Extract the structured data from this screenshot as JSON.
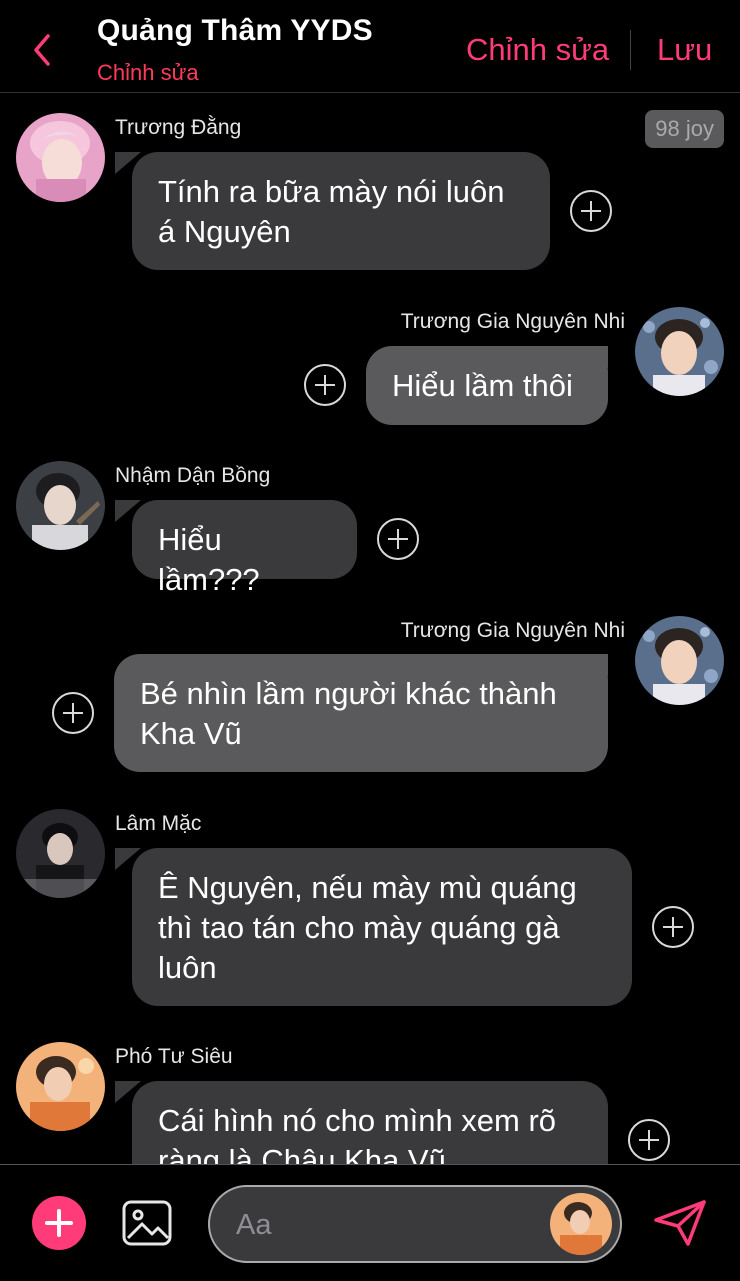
{
  "header": {
    "title": "Quảng Thâm YYDS",
    "subtitle": "Chỉnh sửa",
    "edit_label": "Chỉnh sửa",
    "save_label": "Lưu",
    "accent": "#ff3b7a"
  },
  "badge": {
    "label": "98 joy"
  },
  "messages": [
    {
      "side": "left",
      "sender": "Trương Đằng",
      "text": "Tính ra bữa mày nói luôn á Nguyên"
    },
    {
      "side": "right",
      "sender": "Trương Gia Nguyên Nhi",
      "text": "Hiểu lầm thôi"
    },
    {
      "side": "left",
      "sender": "Nhậm Dận Bồng",
      "text": "Hiểu lầm???"
    },
    {
      "side": "right",
      "sender": "Trương Gia Nguyên Nhi",
      "text": "Bé nhìn lầm người khác thành Kha Vũ"
    },
    {
      "side": "left",
      "sender": "Lâm Mặc",
      "text": "Ê Nguyên, nếu mày mù quáng thì tao tán cho mày quáng gà luôn"
    },
    {
      "side": "left",
      "sender": "Phó Tư Siêu",
      "text": "Cái hình nó cho mình xem rõ ràng là Châu Kha Vũ"
    }
  ],
  "composer": {
    "placeholder": "Aa",
    "add_icon": "plus-icon",
    "image_icon": "image-icon",
    "send_icon": "send-icon"
  }
}
